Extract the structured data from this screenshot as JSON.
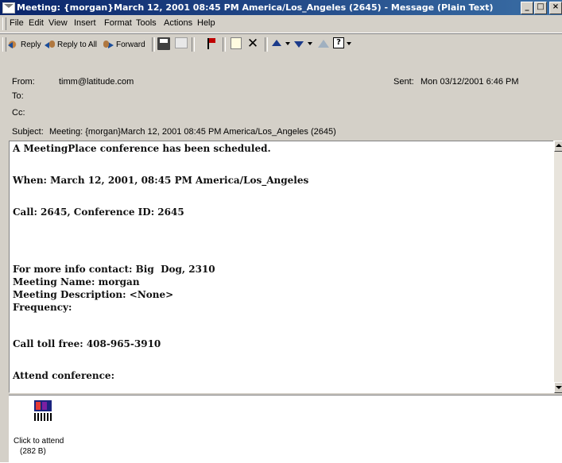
{
  "window": {
    "title": "Meeting: {morgan}March 12, 2001 08:45 PM America/Los_Angeles (2645) - Message (Plain Text)"
  },
  "menu": [
    "File",
    "Edit",
    "View",
    "Insert",
    "Format",
    "Tools",
    "Actions",
    "Help"
  ],
  "toolbar": {
    "reply": "Reply",
    "reply_all": "Reply to All",
    "forward": "Forward"
  },
  "header": {
    "from_label": "From:",
    "from_value": "timm@latitude.com",
    "sent_label": "Sent:",
    "sent_value": "Mon 03/12/2001 6:46 PM",
    "to_label": "To:",
    "to_value": "",
    "cc_label": "Cc:",
    "cc_value": "",
    "subject_label": "Subject:",
    "subject_value": "Meeting: {morgan}March 12, 2001 08:45 PM America/Los_Angeles (2645)"
  },
  "body": {
    "lines": [
      "A MeetingPlace conference has been scheduled.",
      "When: March 12, 2001, 08:45 PM America/Los_Angeles",
      "Call: 2645, Conference ID: 2645",
      "For more info contact: Big  Dog, 2310",
      "Meeting Name: morgan",
      "Meeting Description: <None>",
      "Frequency:",
      "Call toll free: 408-965-3910",
      "Attend conference:"
    ]
  },
  "attachment": {
    "label": "Click to attend",
    "size": "(282 B)"
  }
}
